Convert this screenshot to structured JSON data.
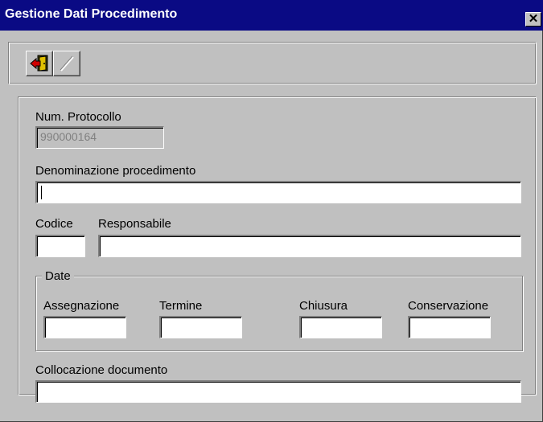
{
  "window": {
    "title": "Gestione Dati Procedimento",
    "close_glyph": "✕"
  },
  "toolbar": {
    "buttons": [
      {
        "name": "exit-icon",
        "enabled": true
      },
      {
        "name": "edit-pencil-icon",
        "enabled": false
      }
    ]
  },
  "form": {
    "num_protocollo": {
      "label": "Num. Protocollo",
      "value": "990000164"
    },
    "denominazione": {
      "label": "Denominazione procedimento",
      "value": ""
    },
    "codice": {
      "label": "Codice",
      "value": ""
    },
    "responsabile": {
      "label": "Responsabile",
      "value": ""
    },
    "date_group": {
      "legend": "Date",
      "assegnazione": {
        "label": "Assegnazione",
        "value": ""
      },
      "termine": {
        "label": "Termine",
        "value": ""
      },
      "chiusura": {
        "label": "Chiusura",
        "value": ""
      },
      "conservazione": {
        "label": "Conservazione",
        "value": ""
      }
    },
    "collocazione": {
      "label": "Collocazione documento",
      "value": ""
    }
  },
  "colors": {
    "titlebar": "#0a0a84",
    "face": "#c0c0c0"
  }
}
